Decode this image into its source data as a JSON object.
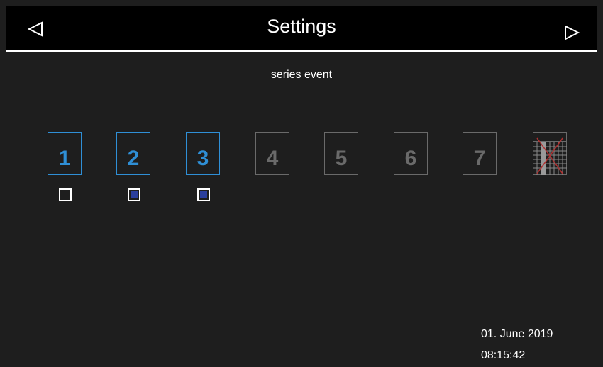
{
  "header": {
    "title": "Settings"
  },
  "subtitle": "series event",
  "days": [
    {
      "number": "1",
      "active": true
    },
    {
      "number": "2",
      "active": true
    },
    {
      "number": "3",
      "active": true
    },
    {
      "number": "4",
      "active": false
    },
    {
      "number": "5",
      "active": false
    },
    {
      "number": "6",
      "active": false
    },
    {
      "number": "7",
      "active": false
    }
  ],
  "checkboxes": [
    {
      "checked": false
    },
    {
      "checked": true
    },
    {
      "checked": true
    }
  ],
  "status": {
    "date": "01. June 2019",
    "time": "08:15:42"
  },
  "colors": {
    "active": "#2f8fd6",
    "inactive": "#6a6a6a",
    "checked_fill": "#2b3f9e",
    "header_bg": "#000000",
    "background": "#1e1e1e"
  }
}
